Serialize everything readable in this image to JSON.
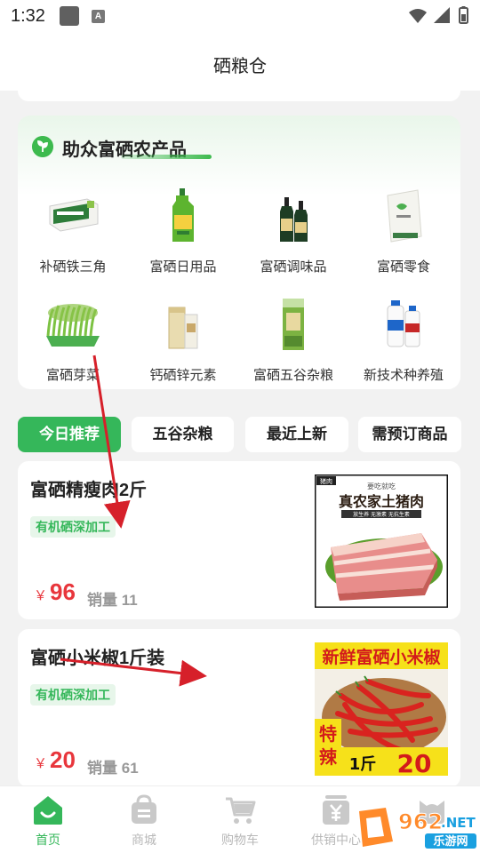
{
  "status_bar": {
    "time": "1:32",
    "notice_glyph": "A",
    "icons": [
      "wifi-icon",
      "signal-icon",
      "battery-icon"
    ]
  },
  "header": {
    "title": "硒粮仓"
  },
  "category_section": {
    "title": "助众富硒农产品",
    "items": [
      {
        "label": "补硒铁三角",
        "icon": "product-box-icon"
      },
      {
        "label": "富硒日用品",
        "icon": "detergent-bottle-icon"
      },
      {
        "label": "富硒调味品",
        "icon": "sauce-bottles-icon"
      },
      {
        "label": "富硒零食",
        "icon": "snack-bag-icon"
      },
      {
        "label": "富硒芽菜",
        "icon": "sprouts-tray-icon"
      },
      {
        "label": "钙硒锌元素",
        "icon": "supplement-jar-icon"
      },
      {
        "label": "富硒五谷杂粮",
        "icon": "grain-bag-icon"
      },
      {
        "label": "新技术种养殖",
        "icon": "fertilizer-bottles-icon"
      }
    ]
  },
  "tabs": [
    {
      "label": "今日推荐",
      "active": true
    },
    {
      "label": "五谷杂粮",
      "active": false
    },
    {
      "label": "最近上新",
      "active": false
    },
    {
      "label": "需预订商品",
      "active": false
    }
  ],
  "products": [
    {
      "name": "富硒精瘦肉2斤",
      "tag": "有机硒深加工",
      "currency": "￥",
      "price": "96",
      "sales_label": "销量",
      "sales": "11",
      "image": {
        "corner_tag": "猪肉",
        "top_text": "要吃就吃",
        "headline": "真农家土猪肉",
        "subline": "放生养 无激素 无抗生素"
      }
    },
    {
      "name": "富硒小米椒1斤装",
      "tag": "有机硒深加工",
      "currency": "￥",
      "price": "20",
      "sales_label": "销量",
      "sales": "61",
      "image": {
        "headline": "新鲜富硒小米椒",
        "badge_top": "特",
        "badge_bottom": "辣",
        "unit": "1斤",
        "price_text": "20"
      }
    }
  ],
  "tab_bar": {
    "items": [
      {
        "label": "首页",
        "icon": "home-icon",
        "active": true
      },
      {
        "label": "商城",
        "icon": "shop-bag-icon",
        "active": false
      },
      {
        "label": "购物车",
        "icon": "cart-icon",
        "active": false
      },
      {
        "label": "供销中心",
        "icon": "supply-center-icon",
        "active": false
      },
      {
        "label": "",
        "icon": "profile-icon",
        "active": false
      }
    ]
  },
  "watermark": {
    "brand": "962",
    "domain": ".NET",
    "site_name": "乐游网"
  },
  "colors": {
    "accent": "#35b75a",
    "price": "#e8363c",
    "annotation": "#d6202a",
    "tag_bg": "#e7f6ea"
  }
}
